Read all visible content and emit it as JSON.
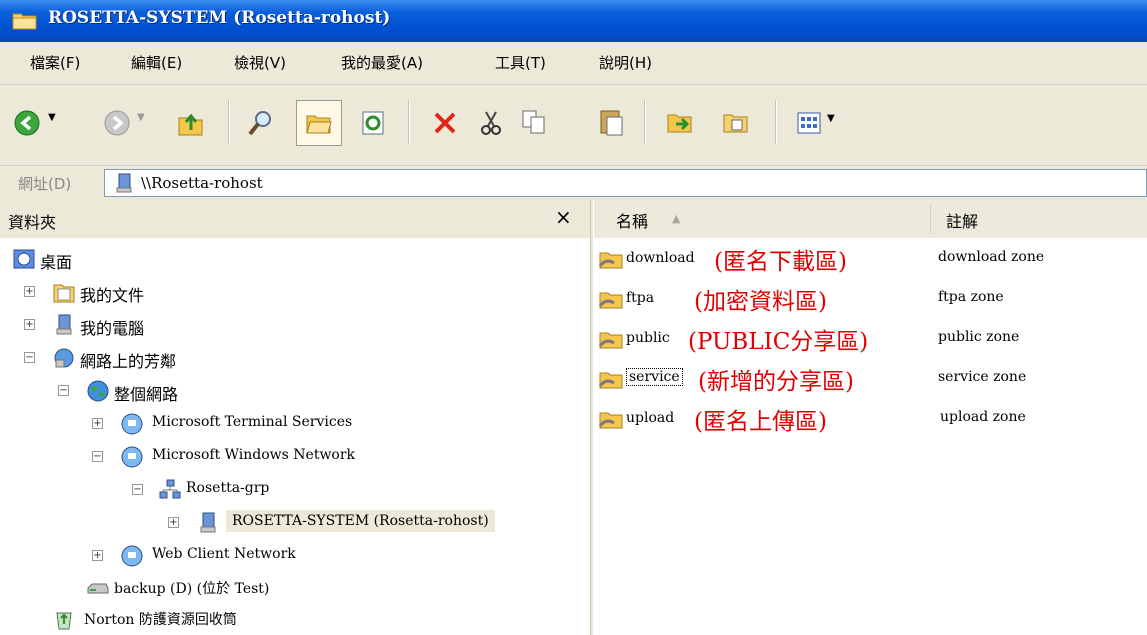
{
  "window": {
    "title": "ROSETTA-SYSTEM (Rosetta-rohost)"
  },
  "menu": [
    "檔案(F)",
    "編輯(E)",
    "檢視(V)",
    "我的最愛(A)",
    "工具(T)",
    "說明(H)"
  ],
  "toolbar": {
    "buttons": [
      "back-icon",
      "forward-icon",
      "up-folder-icon",
      "search-icon",
      "folders-icon",
      "sync-icon",
      "delete-icon",
      "cut-icon",
      "copy-icon",
      "paste-icon",
      "move-to-icon",
      "copy-to-icon",
      "views-icon"
    ]
  },
  "address": {
    "label": "網址(D)",
    "value": "\\\\Rosetta-rohost"
  },
  "folder_pane": {
    "title": "資料夾",
    "close": "×",
    "tree": [
      {
        "label": "桌面",
        "icon": "desktop-icon"
      },
      {
        "label": "我的文件",
        "icon": "documents-icon",
        "expander": "+"
      },
      {
        "label": "我的電腦",
        "icon": "computer-icon",
        "expander": "+"
      },
      {
        "label": "網路上的芳鄰",
        "icon": "network-places-icon",
        "expander": "−"
      },
      {
        "label": "整個網路",
        "icon": "globe-icon",
        "expander": "−"
      },
      {
        "label": "Microsoft Terminal Services",
        "icon": "network-icon",
        "expander": "+"
      },
      {
        "label": "Microsoft Windows Network",
        "icon": "network-icon",
        "expander": "−"
      },
      {
        "label": "Rosetta-grp",
        "icon": "workgroup-icon",
        "expander": "−"
      },
      {
        "label": "ROSETTA-SYSTEM (Rosetta-rohost)",
        "icon": "server-icon",
        "expander": "+",
        "selected": true
      },
      {
        "label": "Web Client Network",
        "icon": "network-icon",
        "expander": "+"
      },
      {
        "label": "backup (D) (位於 Test)",
        "icon": "drive-icon"
      },
      {
        "label": "Norton 防護資源回收筒",
        "icon": "recycle-bin-icon"
      }
    ]
  },
  "list": {
    "columns": [
      "名稱",
      "註解"
    ],
    "sort_arrow": "▲",
    "rows": [
      {
        "name": "download",
        "annotation": "(匿名下載區)",
        "comment": "download zone"
      },
      {
        "name": "ftpa",
        "annotation": "(加密資料區)",
        "comment": "ftpa zone"
      },
      {
        "name": "public",
        "annotation": "(PUBLIC分享區)",
        "comment": "public zone"
      },
      {
        "name": "service",
        "annotation": "(新增的分享區)",
        "comment": "service zone"
      },
      {
        "name": "upload",
        "annotation": "(匿名上傳區)",
        "comment": "upload zone"
      }
    ]
  },
  "colors": {
    "titlebar": "#0a5ed8",
    "chrome": "#ece9d8",
    "annotation": "#e00000",
    "selection": "#ece9d8"
  }
}
